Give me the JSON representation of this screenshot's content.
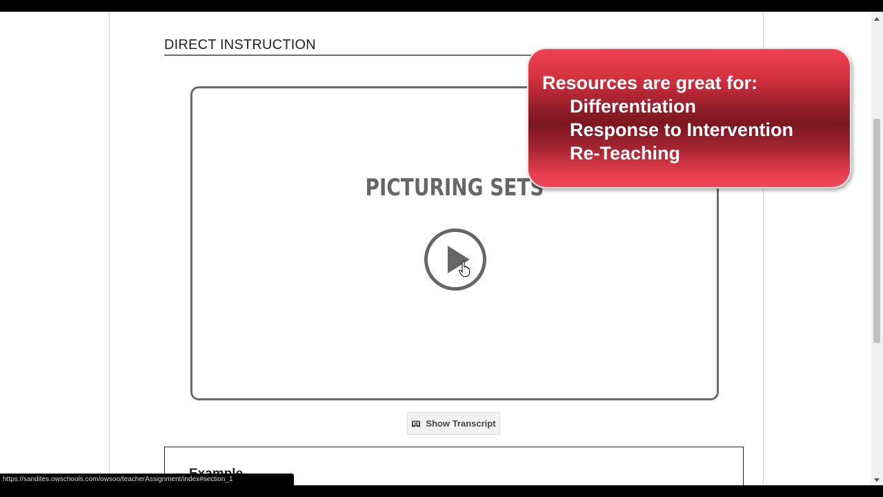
{
  "section": {
    "title": "DIRECT INSTRUCTION"
  },
  "video": {
    "title": "PICTURING SETS",
    "play_icon": "play-icon"
  },
  "transcript": {
    "label": "Show Transcript",
    "icon": "book-icon"
  },
  "example": {
    "heading": "Example"
  },
  "status": {
    "url": "https://sandites.owschools.com/owsoo/teacherAssignment/index#section_1"
  },
  "callout": {
    "heading": "Resources are great for:",
    "items": [
      "Differentiation",
      "Response to Intervention",
      "Re-Teaching"
    ]
  },
  "colors": {
    "callout_red": "#e23b49",
    "frame_gray": "#6a6a6a",
    "title_gray": "#666666"
  }
}
